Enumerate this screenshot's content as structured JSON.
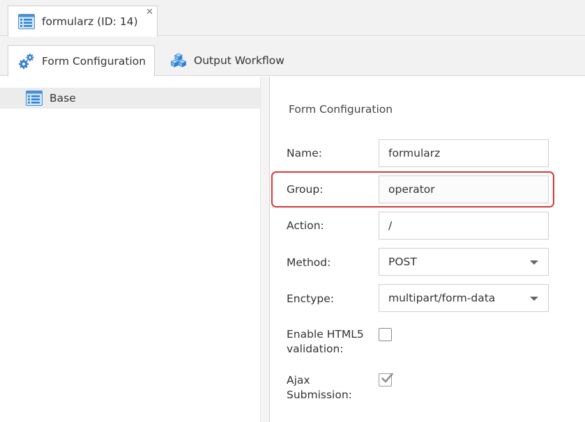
{
  "document_tab": {
    "label": "formularz (ID: 14)",
    "icon": "form-icon",
    "close_symbol": "✕"
  },
  "sub_tabs": [
    {
      "label": "Form Configuration",
      "icon": "gears-icon",
      "active": true
    },
    {
      "label": "Output Workflow",
      "icon": "cubes-icon",
      "active": false
    }
  ],
  "tree": {
    "items": [
      {
        "label": "Base",
        "icon": "form-icon",
        "selected": true
      }
    ]
  },
  "form": {
    "title": "Form Configuration",
    "name": {
      "label": "Name:",
      "value": "formularz"
    },
    "group": {
      "label": "Group:",
      "value": "operator"
    },
    "action": {
      "label": "Action:",
      "value": "/"
    },
    "method": {
      "label": "Method:",
      "value": "POST"
    },
    "enctype": {
      "label": "Enctype:",
      "value": "multipart/form-data"
    },
    "html5_validation": {
      "label_line1": "Enable HTML5",
      "label_line2": "validation:",
      "checked": false
    },
    "ajax_submission": {
      "label_line1": "Ajax",
      "label_line2": "Submission:",
      "checked": true
    }
  },
  "colors": {
    "highlight": "#e03535",
    "icon_blue": "#2f7fd4",
    "icon_light_blue": "#a9d3f2"
  }
}
